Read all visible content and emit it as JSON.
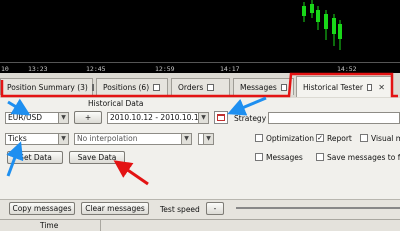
{
  "chart": {
    "time_labels": [
      "10",
      "13:23",
      "12:45",
      "12:59",
      "14:17",
      "14:52"
    ],
    "candle_color": "#19d819"
  },
  "tabs": [
    {
      "label": "Position Summary (3)"
    },
    {
      "label": "Positions (6)"
    },
    {
      "label": "Orders"
    },
    {
      "label": "Messages"
    },
    {
      "label": "Historical Tester"
    }
  ],
  "tester": {
    "section_title": "Historical Data",
    "instrument": "EUR/USD",
    "add_label": "+",
    "date_range": "2010.10.12 - 2010.10.16",
    "strategy_label": "Strategy",
    "period": "Ticks",
    "interpolation": "No interpolation",
    "get_data_label": "Get Data",
    "save_data_label": "Save Data",
    "options": {
      "optimization": {
        "label": "Optimization",
        "checked": false
      },
      "report": {
        "label": "Report",
        "checked": true
      },
      "visual_mode": {
        "label": "Visual mo",
        "checked": false
      },
      "messages": {
        "label": "Messages",
        "checked": false
      },
      "save_messages": {
        "label": "Save messages to file",
        "checked": false
      }
    }
  },
  "bottom": {
    "copy_messages_label": "Copy messages",
    "clear_messages_label": "Clear messages",
    "test_speed_label": "Test speed",
    "speed_minus": "-"
  },
  "table": {
    "columns": [
      "Time"
    ]
  },
  "annotations": {
    "highlight_color": "#e31313",
    "arrow_blue": "#1e8ff0",
    "arrow_red": "#e31313"
  }
}
